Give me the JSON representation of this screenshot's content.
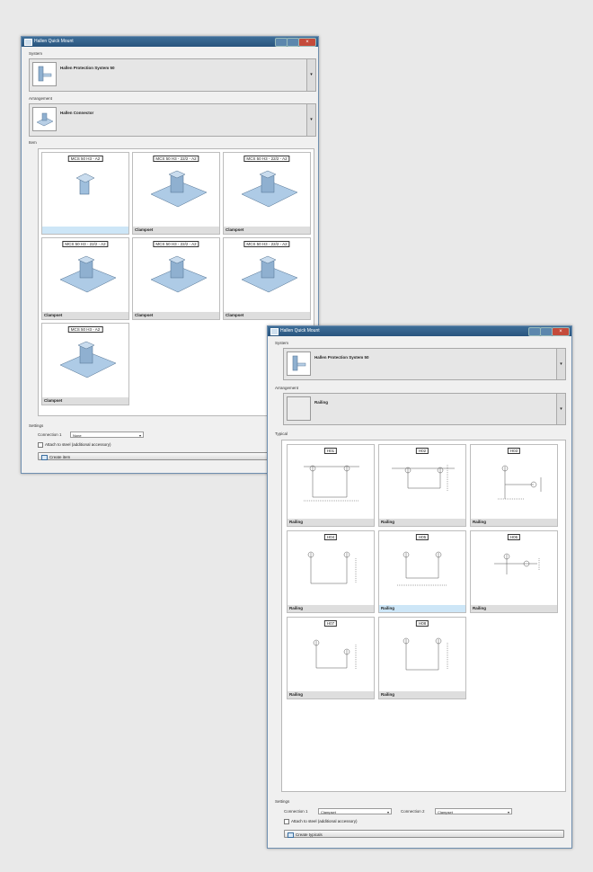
{
  "window1": {
    "title": "Hallen Quick Mount",
    "system_label": "System",
    "system_value": "Hallen Protection System 50",
    "arrangement_label": "Arrangement",
    "arrangement_value": "Hallen Connector",
    "items_label": "Item",
    "items": [
      {
        "code": "MCS 50 H3 - A2",
        "caption": ""
      },
      {
        "code": "MCS 50 H3 - 22/2 - A2",
        "caption": "Clampset"
      },
      {
        "code": "MCS 50 H3 - 22/2 - A2",
        "caption": "Clampset"
      },
      {
        "code": "MCS 50 H3 - 22/2 - A2",
        "caption": "Clampset"
      },
      {
        "code": "MCS 50 H3 - 22/2 - A2",
        "caption": "Clampset"
      },
      {
        "code": "MCS 50 H3 - 22/2 - A2",
        "caption": "Clampset"
      },
      {
        "code": "MCS 50 H3 - A2",
        "caption": "Clampset"
      }
    ],
    "settings_label": "Settings",
    "connection_label": "Connection 1",
    "connection_value": "None",
    "checkbox_label": "Attach to steel (additional accessory)",
    "create_button": "Create item"
  },
  "window2": {
    "title": "Hallen Quick Mount",
    "system_label": "System",
    "system_value": "Hallen Protection System 50",
    "arrangement_label": "Arrangement",
    "arrangement_value": "Railing",
    "types_label": "Typical",
    "items": [
      {
        "code": "H01",
        "caption": "Railing"
      },
      {
        "code": "H02",
        "caption": "Railing"
      },
      {
        "code": "H03",
        "caption": "Railing"
      },
      {
        "code": "H04",
        "caption": "Railing"
      },
      {
        "code": "H05",
        "caption": "Railing"
      },
      {
        "code": "H06",
        "caption": "Railing"
      },
      {
        "code": "H07",
        "caption": "Railing"
      },
      {
        "code": "H08",
        "caption": "Railing"
      }
    ],
    "settings_label": "Settings",
    "connection1_label": "Connection 1",
    "connection1_value": "Clampset",
    "connection2_label": "Connection 2",
    "connection2_value": "Clampset",
    "checkbox_label": "Attach to steel (additional accessory)",
    "create_button": "Create typicals"
  },
  "colors": {
    "titlebar": "#2f5f8a",
    "close": "#c44b3b",
    "selection": "#cde6f7"
  }
}
